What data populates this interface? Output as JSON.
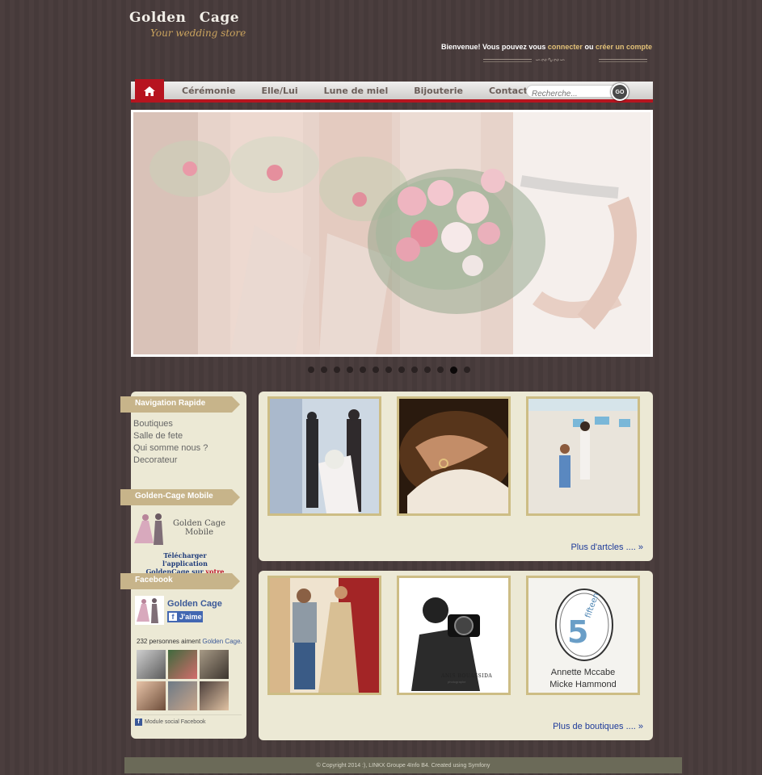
{
  "brand": {
    "title": "Golden   Cage",
    "subtitle": "Your wedding store"
  },
  "welcome": {
    "text": "Bienvenue! Vous pouvez vous",
    "login_link": "connecter",
    "or": "ou",
    "register_link": "créer un compte"
  },
  "nav": {
    "items": [
      "Cérémonie",
      "Elle/Lui",
      "Lune de miel",
      "Bijouterie",
      "Contact"
    ],
    "search_placeholder": "Recherche...",
    "go_label": "GO"
  },
  "slider": {
    "dots_count": 13,
    "active_index": 11
  },
  "sidebar": {
    "nav_title": "Navigation Rapide",
    "links": [
      "Boutiques",
      "Salle de fete",
      "Qui somme nous ?",
      "Decorateur"
    ],
    "mobile_title": "Golden-Cage Mobile",
    "mobile_app_name_line1": "Golden Cage",
    "mobile_app_name_line2": "Mobile",
    "mobile_download_line1": "Télécharger l'application",
    "mobile_download_line2": "GoldenCage sur",
    "mobile_download_red": "votre mobile",
    "facebook_title": "Facebook",
    "fb_page_name": "Golden Cage",
    "fb_like_label": "J'aime",
    "fb_count_text": "232 personnes aiment",
    "fb_count_link": "Golden Cage.",
    "fb_footer": "Module social Facebook"
  },
  "articles": {
    "more_label": "Plus d'artcles .... »"
  },
  "shops": {
    "more_label": "Plus de boutiques .... »",
    "photographer_caption": "ANIS BOUASSIDA",
    "photographer_sub": "photographe",
    "logo_name_line1": "Annette Mccabe",
    "logo_name_line2": "Micke Hammond"
  },
  "footer": {
    "text": "© Copyright 2014 :), LINKX Groupe 4Info B4. Created using Symfony"
  }
}
